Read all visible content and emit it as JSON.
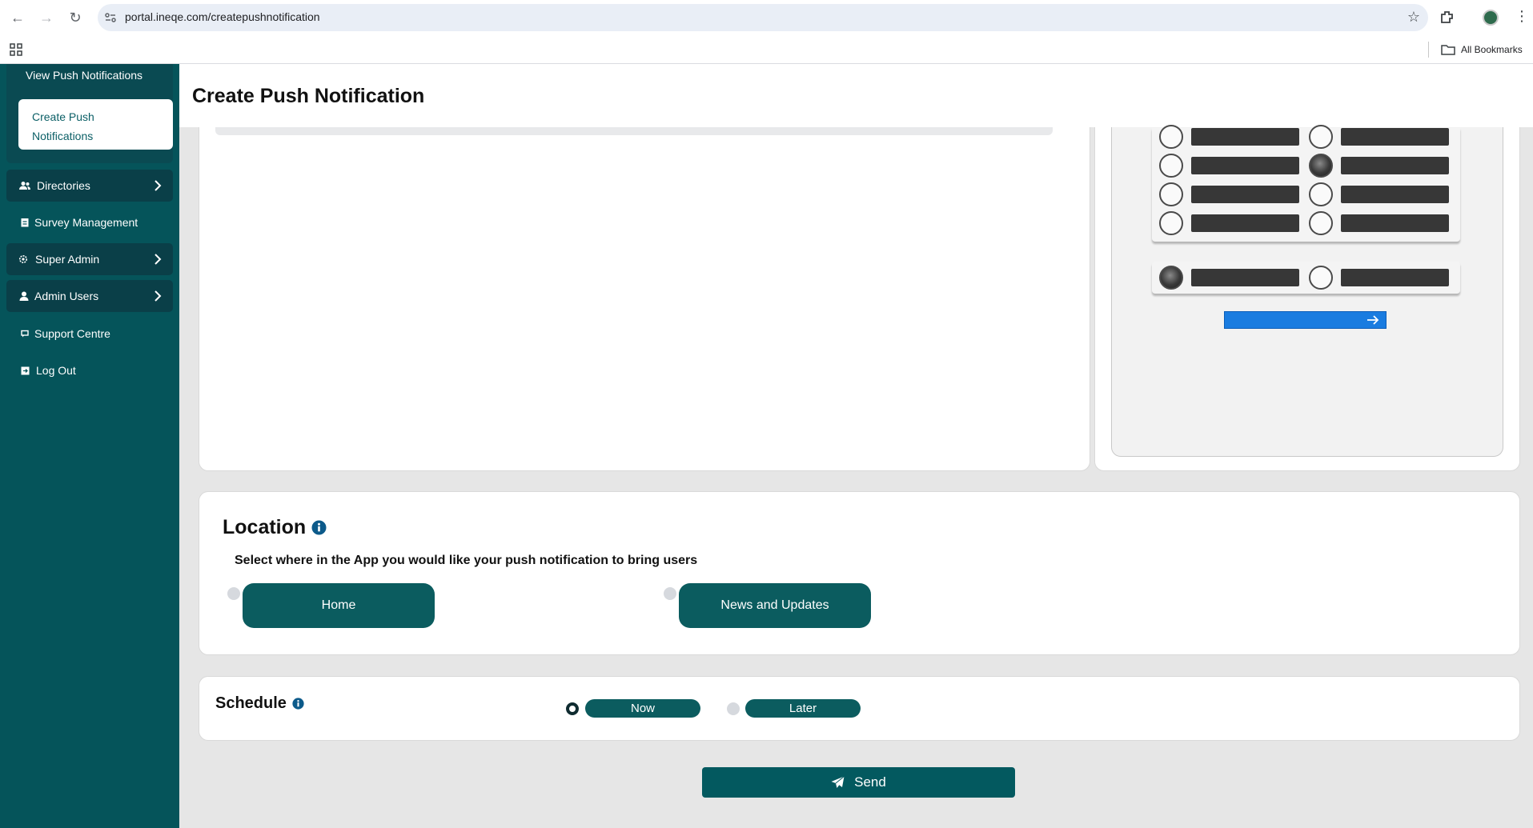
{
  "browser": {
    "url": "portal.ineqe.com/createpushnotification",
    "bookmarks_label": "All Bookmarks"
  },
  "sidebar": {
    "view_push": "View Push Notifications",
    "create_push_line1": "Create Push",
    "create_push_line2": "Notifications",
    "items": [
      {
        "label": "Directories",
        "icon": "people-icon",
        "has_chevron": true
      },
      {
        "label": "Survey Management",
        "icon": "clipboard-icon",
        "has_chevron": false
      },
      {
        "label": "Super Admin",
        "icon": "gear-icon",
        "has_chevron": true
      },
      {
        "label": "Admin Users",
        "icon": "person-icon",
        "has_chevron": true
      },
      {
        "label": "Support Centre",
        "icon": "chat-icon",
        "has_chevron": false
      },
      {
        "label": "Log Out",
        "icon": "logout-icon",
        "has_chevron": false
      }
    ]
  },
  "page": {
    "title": "Create Push Notification"
  },
  "location": {
    "title": "Location",
    "subtitle": "Select where in the App you would like your push notification to bring users",
    "options": [
      "Home",
      "News and Updates"
    ]
  },
  "schedule": {
    "title": "Schedule",
    "options": [
      "Now",
      "Later"
    ],
    "selected": "Now"
  },
  "actions": {
    "send": "Send"
  },
  "colors": {
    "sidebar_bg": "#05545a",
    "teal_button": "#0b5c5f",
    "preview_next": "#1a7ce0"
  }
}
